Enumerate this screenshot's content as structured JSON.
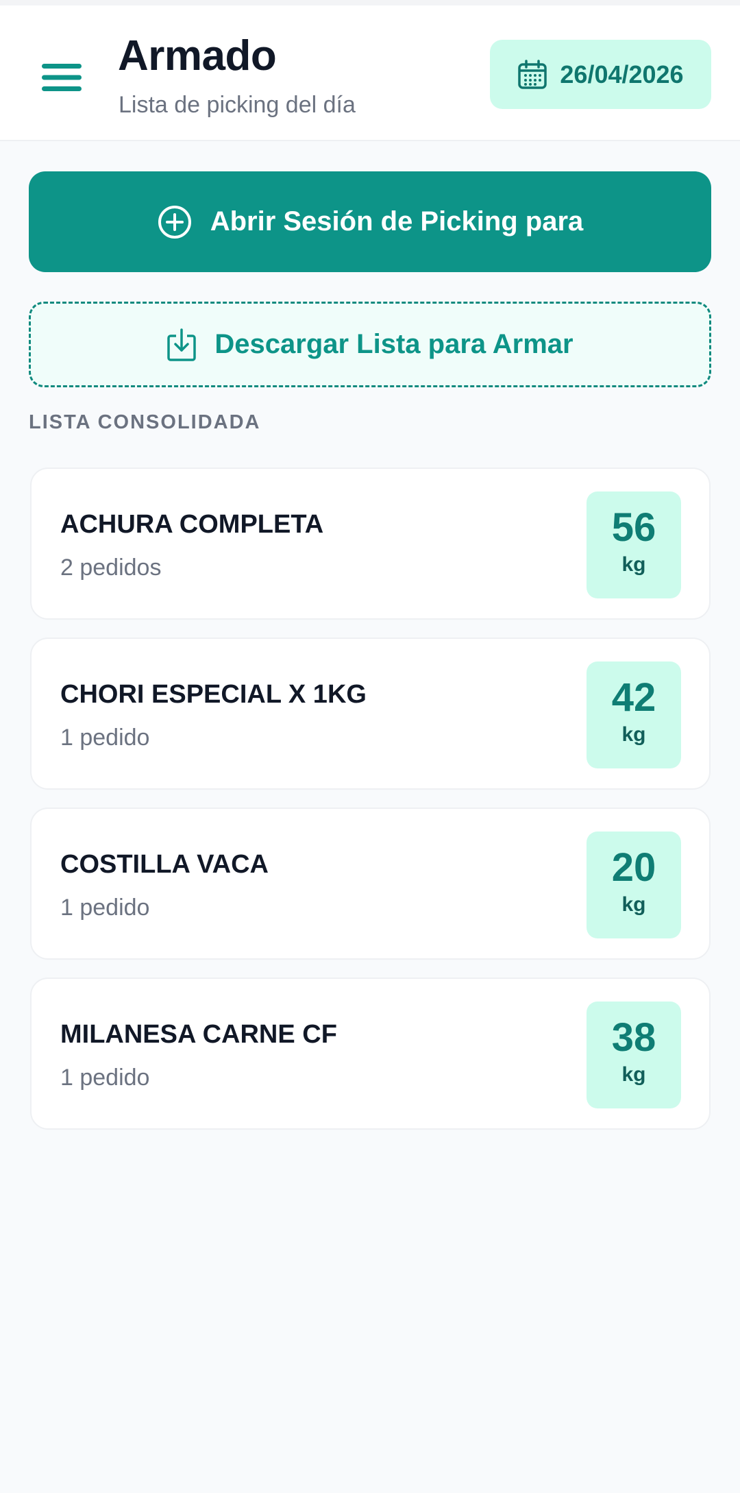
{
  "header": {
    "title": "Armado",
    "subtitle": "Lista de picking del día",
    "date": "26/04/2026",
    "menu_icon": "hamburger-menu-icon",
    "date_icon": "calendar-icon"
  },
  "actions": {
    "open_session_label": "Abrir Sesión de Picking para",
    "open_session_icon": "plus-circle-icon",
    "download_label": "Descargar Lista para Armar",
    "download_icon": "download-icon"
  },
  "section": {
    "label": "LISTA CONSOLIDADA"
  },
  "items": [
    {
      "name": "ACHURA COMPLETA",
      "orders": "2 pedidos",
      "qty": "56",
      "unit": "kg"
    },
    {
      "name": "CHORI ESPECIAL X 1KG",
      "orders": "1 pedido",
      "qty": "42",
      "unit": "kg"
    },
    {
      "name": "COSTILLA VACA",
      "orders": "1 pedido",
      "qty": "20",
      "unit": "kg"
    },
    {
      "name": "MILANESA CARNE CF",
      "orders": "1 pedido",
      "qty": "38",
      "unit": "kg"
    }
  ],
  "colors": {
    "accent": "#0d9488",
    "accent_light": "#ccfbec",
    "background": "#f8fafc"
  }
}
